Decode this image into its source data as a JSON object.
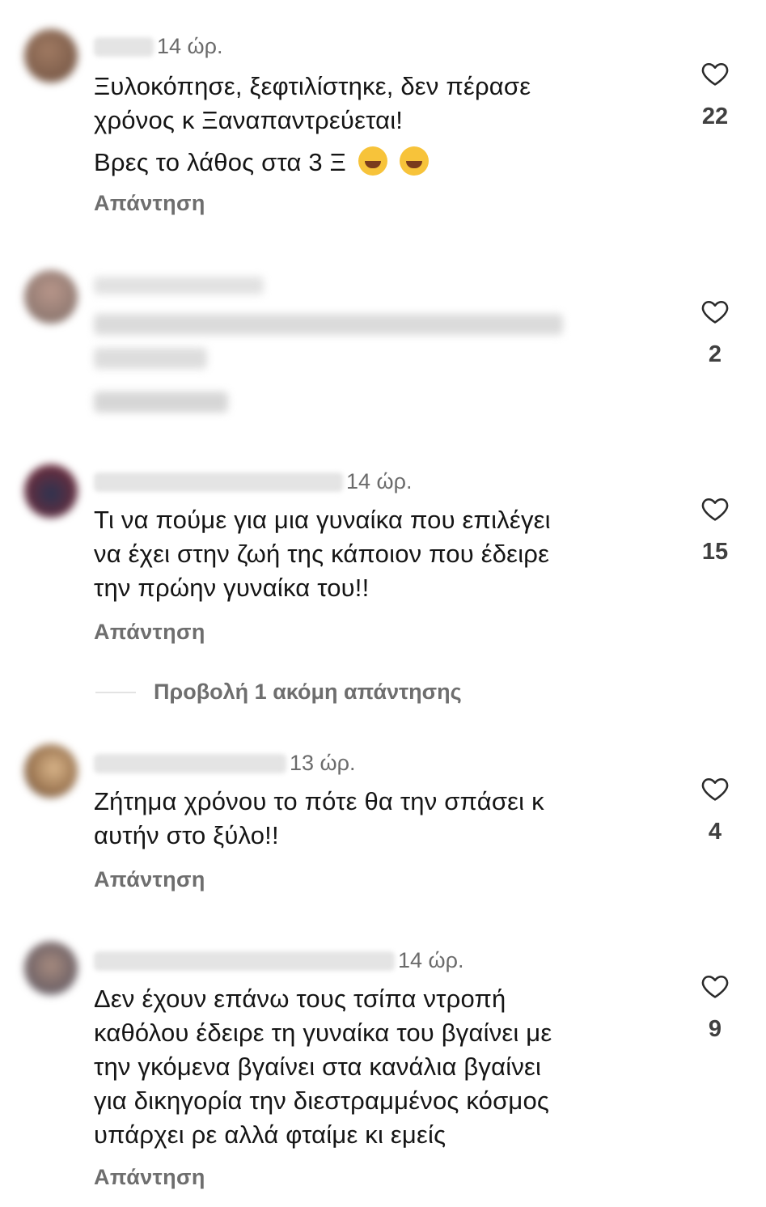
{
  "colors": {
    "text": "#151515",
    "meta": "#6b6b6b",
    "reply": "#6e6e6e",
    "like_count": "#404040"
  },
  "reply_label": "Απάντηση",
  "view_more_label": "Προβολή 1 ακόμη απάντησης",
  "comments": [
    {
      "time": "14 ώρ.",
      "lines": [
        "Ξυλοκόπησε, ξεφτιλίστηκε, δεν πέρασε",
        "χρόνος κ Ξαναπαντρεύεται!"
      ],
      "line2": "Βρες το λάθος στα 3 Ξ",
      "emoji": [
        "rolling-on-floor-laughing",
        "rolling-on-floor-laughing"
      ],
      "likes": "22"
    },
    {
      "time": "",
      "lines": [],
      "likes": "2",
      "blurred": true
    },
    {
      "time": "14 ώρ.",
      "lines": [
        "Τι να πούμε για μια γυναίκα που επιλέγει",
        "να έχει στην ζωή της κάποιον που έδειρε",
        "την πρώην γυναίκα του!!"
      ],
      "likes": "15"
    },
    {
      "time": "13 ώρ.",
      "lines": [
        "Ζήτημα χρόνου το πότε θα την σπάσει κ",
        "αυτήν στο ξύλο!!"
      ],
      "likes": "4"
    },
    {
      "time": "14 ώρ.",
      "lines": [
        "Δεν έχουν επάνω τους τσίπα ντροπή",
        "καθόλου έδειρε τη γυναίκα του βγαίνει με",
        "την γκόμενα βγαίνει στα κανάλια βγαίνει",
        "για δικηγορία την διεστραμμένος κόσμος",
        "υπάρχει ρε αλλά φταίμε κι εμείς"
      ],
      "likes": "9"
    }
  ]
}
